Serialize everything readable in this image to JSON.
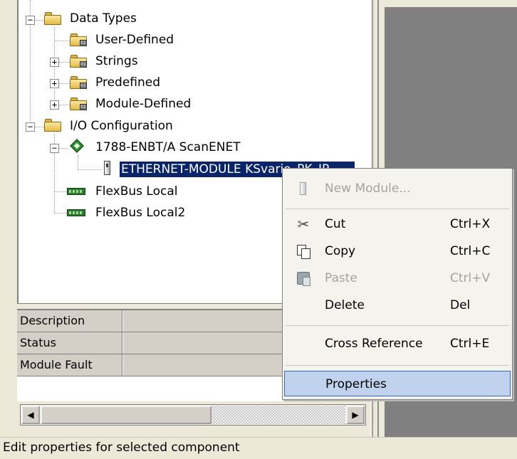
{
  "tree": {
    "items": [
      {
        "label": "Data Types",
        "expander": "−"
      },
      {
        "label": "User-Defined"
      },
      {
        "label": "Strings",
        "expander": "+"
      },
      {
        "label": "Predefined",
        "expander": "+"
      },
      {
        "label": "Module-Defined",
        "expander": "+"
      },
      {
        "label": "I/O Configuration",
        "expander": "−"
      },
      {
        "label": "1788-ENBT/A ScanENET",
        "expander": "−"
      },
      {
        "label": "ETHERNET-MODULE KSvario_PK_IP"
      },
      {
        "label": "FlexBus Local"
      },
      {
        "label": "FlexBus Local2"
      }
    ]
  },
  "properties": {
    "rows": [
      {
        "name": "Description",
        "value": ""
      },
      {
        "name": "Status",
        "value": ""
      },
      {
        "name": "Module Fault",
        "value": ""
      }
    ]
  },
  "scrollbar": {
    "left_arrow": "◀",
    "right_arrow": "▶"
  },
  "context_menu": {
    "new_module": "New Module...",
    "cut": "Cut",
    "cut_key": "Ctrl+X",
    "copy": "Copy",
    "copy_key": "Ctrl+C",
    "paste": "Paste",
    "paste_key": "Ctrl+V",
    "delete": "Delete",
    "delete_key": "Del",
    "cross_reference": "Cross Reference",
    "cross_reference_key": "Ctrl+E",
    "properties": "Properties",
    "cut_icon_glyph": "✂"
  },
  "status_bar": {
    "text": "Edit properties for selected component"
  },
  "colors": {
    "selection": "#0a246a",
    "menu_highlight": "#c1d2ee",
    "workspace": "#808080"
  }
}
